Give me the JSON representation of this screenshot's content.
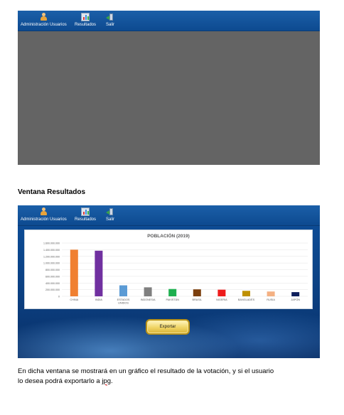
{
  "window1": {
    "toolbar": [
      {
        "label": "Administración Usuarios",
        "icon": "user-icon"
      },
      {
        "label": "Resultados",
        "icon": "chart-icon"
      },
      {
        "label": "Salir",
        "icon": "exit-icon"
      }
    ]
  },
  "caption": "Ventana Resultados",
  "window2": {
    "toolbar": [
      {
        "label": "Administración Usuarios",
        "icon": "user-icon"
      },
      {
        "label": "Resultados",
        "icon": "chart-icon"
      },
      {
        "label": "Salir",
        "icon": "exit-icon"
      }
    ],
    "export_label": "Exportar"
  },
  "description": {
    "line1": "En dicha ventana se mostrará en un gráfico el resultado de la votación, y si el usuario",
    "line2_prefix": "lo desea podrá exportarlo a ",
    "line2_word": "jpg",
    "line2_suffix": "."
  },
  "chart_data": {
    "type": "bar",
    "title": "POBLACIÓN (2019)",
    "categories": [
      "CHINA",
      "INDIA",
      "ESTADOS UNIDOS",
      "INDONESIA",
      "PAKISTÁN",
      "BRASIL",
      "NIGERIA",
      "BANGLADÉS",
      "RUSIA",
      "JAPÓN"
    ],
    "values": [
      1400000000,
      1370000000,
      330000000,
      270000000,
      220000000,
      210000000,
      200000000,
      165000000,
      145000000,
      126000000
    ],
    "colors": [
      "#f08031",
      "#7030a0",
      "#5b9bd5",
      "#7f7f7f",
      "#1eb050",
      "#7b3f0e",
      "#ee1c1c",
      "#bf9000",
      "#f4b183",
      "#0e1e5b"
    ],
    "yticks": [
      "0",
      "200.000.000",
      "400.000.000",
      "600.000.000",
      "800.000.000",
      "1.000.000.000",
      "1.200.000.000",
      "1.400.000.000",
      "1.600.000.000"
    ],
    "ylim": [
      0,
      1600000000
    ],
    "grid": true
  }
}
